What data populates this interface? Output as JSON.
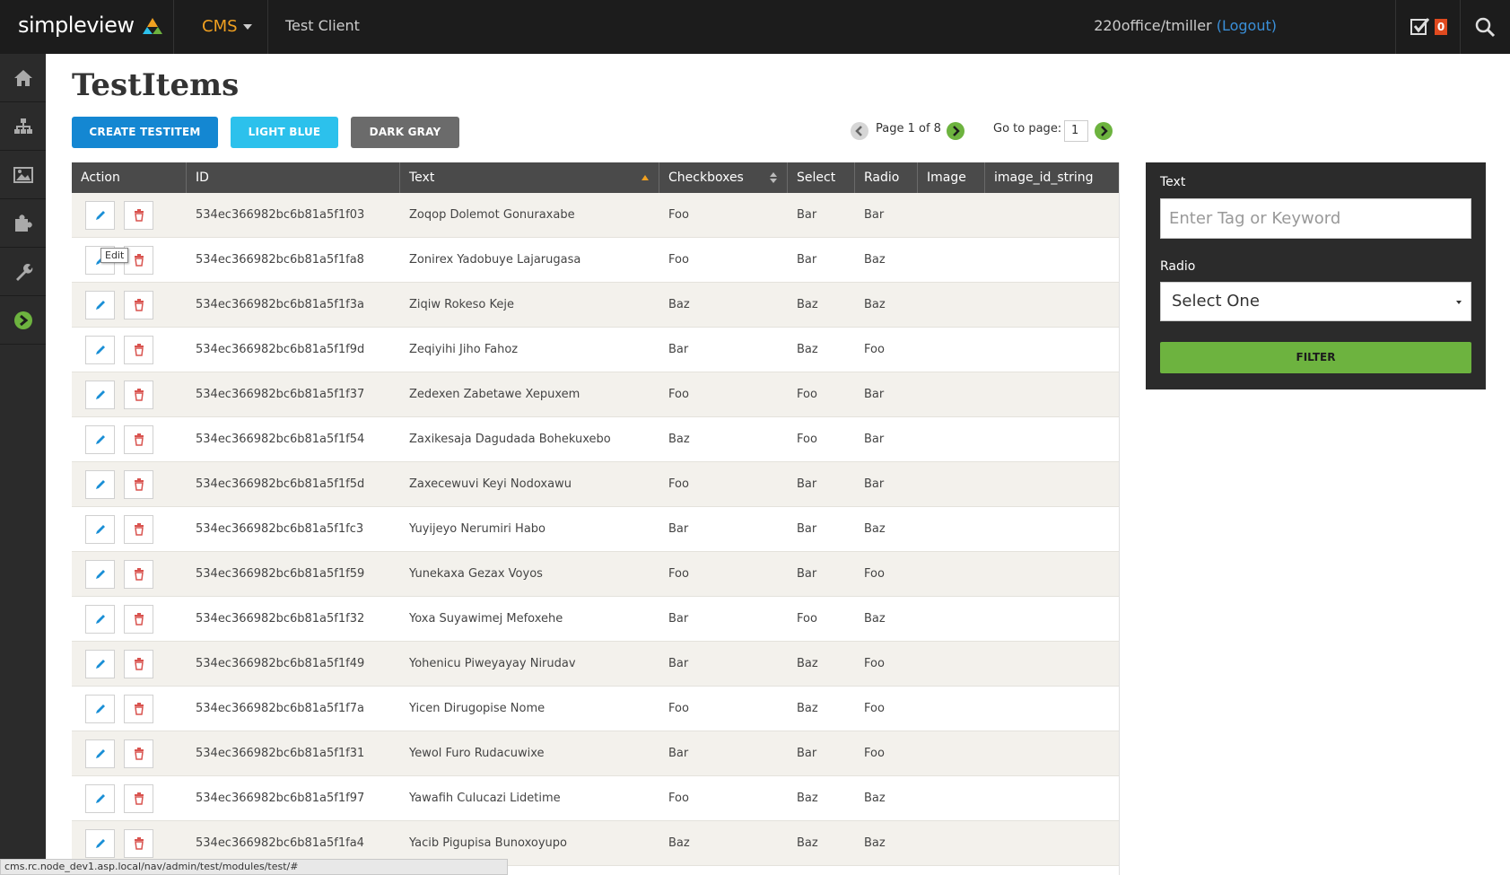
{
  "topbar": {
    "logo": "simpleview",
    "cms_menu": "CMS",
    "client": "Test Client",
    "user": "220office/tmiller",
    "logout": "(Logout)",
    "task_count": "0"
  },
  "sidebar": {
    "items": [
      {
        "icon": "home-icon"
      },
      {
        "icon": "sitemap-icon"
      },
      {
        "icon": "image-icon"
      },
      {
        "icon": "puzzle-icon"
      },
      {
        "icon": "wrench-icon"
      },
      {
        "icon": "arrow-right-circle-icon"
      }
    ]
  },
  "page": {
    "title": "TestItems",
    "buttons": {
      "create": "CREATE TESTITEM",
      "light_blue": "LIGHT BLUE",
      "dark_gray": "DARK GRAY"
    }
  },
  "pagination": {
    "page_text": "Page 1 of 8",
    "goto_label": "Go to page:",
    "goto_value": "1"
  },
  "table": {
    "columns": [
      "Action",
      "ID",
      "Text",
      "Checkboxes",
      "Select",
      "Radio",
      "Image",
      "image_id_string"
    ],
    "tooltip": "Edit",
    "rows": [
      {
        "id": "534ec366982bc6b81a5f1f03",
        "text": "Zoqop Dolemot Gonuraxabe",
        "checkboxes": "Foo",
        "select": "Bar",
        "radio": "Bar"
      },
      {
        "id": "534ec366982bc6b81a5f1fa8",
        "text": "Zonirex Yadobuye Lajarugasa",
        "checkboxes": "Foo",
        "select": "Bar",
        "radio": "Baz"
      },
      {
        "id": "534ec366982bc6b81a5f1f3a",
        "text": "Ziqiw Rokeso Keje",
        "checkboxes": "Baz",
        "select": "Baz",
        "radio": "Baz"
      },
      {
        "id": "534ec366982bc6b81a5f1f9d",
        "text": "Zeqiyihi Jiho Fahoz",
        "checkboxes": "Bar",
        "select": "Baz",
        "radio": "Foo"
      },
      {
        "id": "534ec366982bc6b81a5f1f37",
        "text": "Zedexen Zabetawe Xepuxem",
        "checkboxes": "Foo",
        "select": "Foo",
        "radio": "Bar"
      },
      {
        "id": "534ec366982bc6b81a5f1f54",
        "text": "Zaxikesaja Dagudada Bohekuxebo",
        "checkboxes": "Baz",
        "select": "Foo",
        "radio": "Bar"
      },
      {
        "id": "534ec366982bc6b81a5f1f5d",
        "text": "Zaxecewuvi Keyi Nodoxawu",
        "checkboxes": "Foo",
        "select": "Bar",
        "radio": "Bar"
      },
      {
        "id": "534ec366982bc6b81a5f1fc3",
        "text": "Yuyijeyo Nerumiri Habo",
        "checkboxes": "Bar",
        "select": "Bar",
        "radio": "Baz"
      },
      {
        "id": "534ec366982bc6b81a5f1f59",
        "text": "Yunekaxa Gezax Voyos",
        "checkboxes": "Foo",
        "select": "Bar",
        "radio": "Foo"
      },
      {
        "id": "534ec366982bc6b81a5f1f32",
        "text": "Yoxa Suyawimej Mefoxehe",
        "checkboxes": "Bar",
        "select": "Foo",
        "radio": "Baz"
      },
      {
        "id": "534ec366982bc6b81a5f1f49",
        "text": "Yohenicu Piweyayay Nirudav",
        "checkboxes": "Bar",
        "select": "Baz",
        "radio": "Foo"
      },
      {
        "id": "534ec366982bc6b81a5f1f7a",
        "text": "Yicen Dirugopise Nome",
        "checkboxes": "Foo",
        "select": "Baz",
        "radio": "Foo"
      },
      {
        "id": "534ec366982bc6b81a5f1f31",
        "text": "Yewol Furo Rudacuwixe",
        "checkboxes": "Bar",
        "select": "Bar",
        "radio": "Foo"
      },
      {
        "id": "534ec366982bc6b81a5f1f97",
        "text": "Yawafih Culucazi Lidetime",
        "checkboxes": "Foo",
        "select": "Baz",
        "radio": "Baz"
      },
      {
        "id": "534ec366982bc6b81a5f1fa4",
        "text": "Yacib Pigupisa Bunoxoyupo",
        "checkboxes": "Baz",
        "select": "Baz",
        "radio": "Baz"
      }
    ]
  },
  "filter": {
    "text_label": "Text",
    "text_placeholder": "Enter Tag or Keyword",
    "radio_label": "Radio",
    "radio_value": "Select One",
    "button": "FILTER"
  },
  "statusbar": {
    "url": "cms.rc.node_dev1.asp.local/nav/admin/test/modules/test/#"
  },
  "colors": {
    "topbar": "#1c1c1c",
    "sidebar": "#2b2b2b",
    "accent_orange": "#f0a020",
    "create_blue": "#1487d2",
    "light_blue": "#2cc1ec",
    "dark_gray": "#6b6b6b",
    "green": "#6db33f",
    "edit_icon": "#1a8fd6",
    "delete_icon": "#d9534f"
  }
}
